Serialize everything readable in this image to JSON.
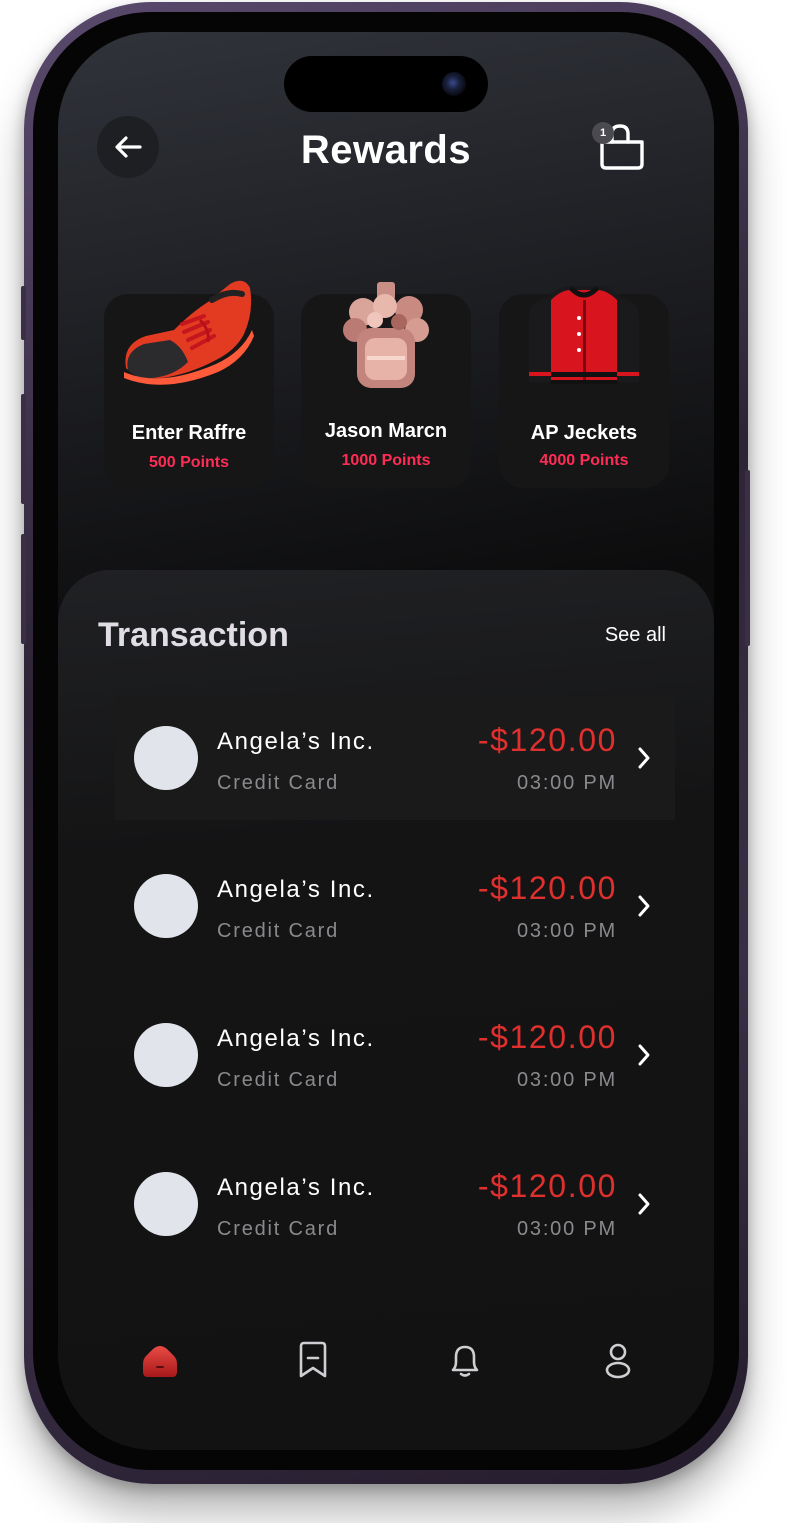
{
  "header": {
    "title": "Rewards",
    "cart_count": "1"
  },
  "rewards": [
    {
      "name": "Enter Raffre",
      "points": "500 Points"
    },
    {
      "name": "Jason Marcn",
      "points": "1000 Points"
    },
    {
      "name": "AP Jeckets",
      "points": "4000 Points"
    }
  ],
  "transactions": {
    "title": "Transaction",
    "see_all": "See all",
    "items": [
      {
        "name": "Angela’s Inc.",
        "method": "Credit Card",
        "amount": "-$120.00",
        "time": "03:00 PM"
      },
      {
        "name": "Angela’s Inc.",
        "method": "Credit Card",
        "amount": "-$120.00",
        "time": "03:00 PM"
      },
      {
        "name": "Angela’s Inc.",
        "method": "Credit Card",
        "amount": "-$120.00",
        "time": "03:00 PM"
      },
      {
        "name": "Angela’s Inc.",
        "method": "Credit Card",
        "amount": "-$120.00",
        "time": "03:00 PM"
      }
    ]
  },
  "nav": {
    "items": [
      {
        "icon": "home-icon",
        "active": true
      },
      {
        "icon": "bookmark-icon",
        "active": false
      },
      {
        "icon": "bell-icon",
        "active": false
      },
      {
        "icon": "profile-icon",
        "active": false
      }
    ]
  },
  "colors": {
    "accent": "#ff2d55",
    "amount_negative": "#e0302e",
    "background": "#0c0c0d",
    "card": "#161617",
    "avatar": "#e2e4ec"
  }
}
